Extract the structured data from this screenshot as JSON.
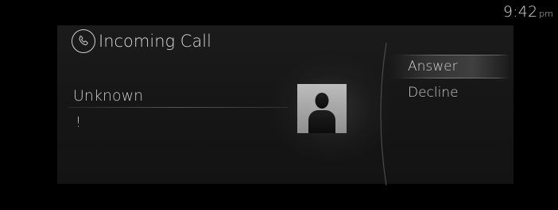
{
  "status_bar": {
    "time": "9:42",
    "ampm": "pm"
  },
  "call": {
    "title": "Incoming Call",
    "title_icon": "phone-icon",
    "caller_name": "Unknown",
    "caller_detail": "!",
    "avatar_icon": "person-silhouette-icon"
  },
  "options": [
    {
      "label": "Answer",
      "selected": true
    },
    {
      "label": "Decline",
      "selected": false
    }
  ],
  "colors": {
    "background": "#000000",
    "card": "#181818",
    "text": "#d2d2d2"
  }
}
